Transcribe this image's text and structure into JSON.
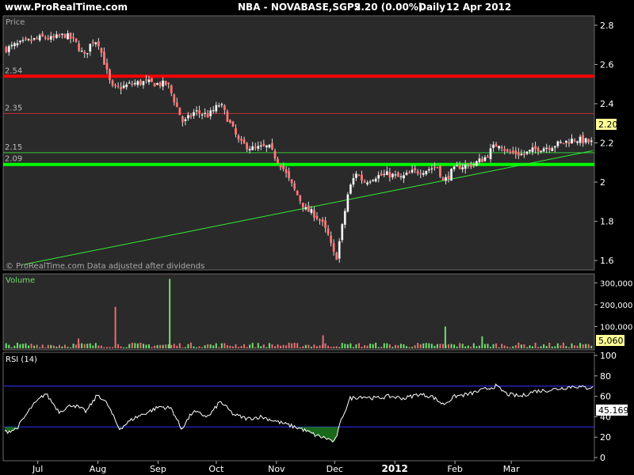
{
  "header": {
    "site": "www.ProRealTime.com",
    "instrument": "NBA - NOVABASE,SGPS",
    "price_change": "2.20 (0.00%)",
    "period": "Daily",
    "date": "12 Apr 2012"
  },
  "price_panel": {
    "label": "Price",
    "watermark": "© ProRealTime.com  Data adjusted after dividends",
    "axis_ticks": [
      "2.8",
      "2.6",
      "2.4",
      "2.2",
      "2",
      "1.8",
      "1.6"
    ],
    "last_price": "2.20"
  },
  "volume_panel": {
    "label": "Volume",
    "axis_ticks": [
      "300,000",
      "200,000",
      "100,000"
    ],
    "last_value": "5,060"
  },
  "rsi_panel": {
    "label": "RSI (14)",
    "axis_ticks": [
      "100",
      "80",
      "60",
      "40",
      "20",
      "0"
    ],
    "last_value": "45.169"
  },
  "x_axis": {
    "labels": [
      "Jul",
      "Aug",
      "Sep",
      "Oct",
      "Nov",
      "Dec",
      "2012",
      "Feb",
      "Mar"
    ]
  },
  "colors": {
    "up": "#ffffff",
    "down": "#ff7f7f",
    "vol_up": "#6fdd6f",
    "vol_down": "#e07070",
    "red_line": "#ff0000",
    "green_line": "#00ff00",
    "thin_red": "#c03030",
    "thin_green": "#33cc33",
    "trend": "#33ee33",
    "rsi_band": "#3333ff"
  },
  "chart_data": [
    {
      "type": "candlestick",
      "title": "",
      "ylabel": "Price",
      "ylim": [
        1.56,
        2.84
      ],
      "x_range": [
        "2011-06-14",
        "2012-04-12"
      ],
      "horizontal_lines": [
        {
          "value": 2.54,
          "label": "2.54",
          "color": "red",
          "style": "thick"
        },
        {
          "value": 2.35,
          "label": "2.35",
          "color": "red",
          "style": "thin"
        },
        {
          "value": 2.15,
          "label": "2.15",
          "color": "green",
          "style": "thin"
        },
        {
          "value": 2.09,
          "label": "2.09",
          "color": "green",
          "style": "thick"
        }
      ],
      "trendline": {
        "from": [
          "2011-06-24",
          1.58
        ],
        "to": [
          "2012-04-12",
          2.16
        ]
      },
      "close_path": [
        [
          "2011-06-15",
          2.68
        ],
        [
          "2011-06-20",
          2.7
        ],
        [
          "2011-06-27",
          2.72
        ],
        [
          "2011-07-04",
          2.74
        ],
        [
          "2011-07-08",
          2.73
        ],
        [
          "2011-07-15",
          2.75
        ],
        [
          "2011-07-20",
          2.72
        ],
        [
          "2011-07-25",
          2.64
        ],
        [
          "2011-07-29",
          2.72
        ],
        [
          "2011-08-01",
          2.72
        ],
        [
          "2011-08-04",
          2.62
        ],
        [
          "2011-08-08",
          2.48
        ],
        [
          "2011-08-12",
          2.48
        ],
        [
          "2011-08-18",
          2.5
        ],
        [
          "2011-08-25",
          2.51
        ],
        [
          "2011-09-01",
          2.5
        ],
        [
          "2011-09-06",
          2.5
        ],
        [
          "2011-09-10",
          2.4
        ],
        [
          "2011-09-14",
          2.3
        ],
        [
          "2011-09-20",
          2.36
        ],
        [
          "2011-09-27",
          2.34
        ],
        [
          "2011-10-03",
          2.4
        ],
        [
          "2011-10-08",
          2.3
        ],
        [
          "2011-10-13",
          2.2
        ],
        [
          "2011-10-20",
          2.17
        ],
        [
          "2011-10-28",
          2.18
        ],
        [
          "2011-11-01",
          2.12
        ],
        [
          "2011-11-04",
          2.08
        ],
        [
          "2011-11-08",
          2.0
        ],
        [
          "2011-11-12",
          1.93
        ],
        [
          "2011-11-16",
          1.86
        ],
        [
          "2011-11-20",
          1.84
        ],
        [
          "2011-11-24",
          1.8
        ],
        [
          "2011-11-28",
          1.72
        ],
        [
          "2011-11-30",
          1.64
        ],
        [
          "2011-12-02",
          1.62
        ],
        [
          "2011-12-05",
          1.78
        ],
        [
          "2011-12-08",
          1.95
        ],
        [
          "2011-12-12",
          2.05
        ],
        [
          "2011-12-16",
          2.0
        ],
        [
          "2011-12-22",
          2.03
        ],
        [
          "2011-12-29",
          2.04
        ],
        [
          "2012-01-04",
          2.02
        ],
        [
          "2012-01-10",
          2.05
        ],
        [
          "2012-01-16",
          2.06
        ],
        [
          "2012-01-23",
          2.08
        ],
        [
          "2012-01-26",
          2.0
        ],
        [
          "2012-01-30",
          2.05
        ],
        [
          "2012-02-03",
          2.08
        ],
        [
          "2012-02-10",
          2.09
        ],
        [
          "2012-02-16",
          2.12
        ],
        [
          "2012-02-21",
          2.18
        ],
        [
          "2012-02-24",
          2.2
        ],
        [
          "2012-02-28",
          2.15
        ],
        [
          "2012-03-02",
          2.15
        ],
        [
          "2012-03-07",
          2.14
        ],
        [
          "2012-03-14",
          2.17
        ],
        [
          "2012-03-20",
          2.18
        ],
        [
          "2012-03-27",
          2.2
        ],
        [
          "2012-04-03",
          2.22
        ],
        [
          "2012-04-12",
          2.2
        ]
      ]
    },
    {
      "type": "bar",
      "title": "",
      "ylabel": "Volume",
      "ylim": [
        0,
        330000
      ],
      "typical_volume": 14000,
      "peaks": [
        {
          "date": "2011-08-10",
          "value": 190000,
          "direction": "down"
        },
        {
          "date": "2011-09-07",
          "value": 318000,
          "direction": "up"
        },
        {
          "date": "2012-01-27",
          "value": 100000,
          "direction": "up"
        },
        {
          "date": "2012-02-15",
          "value": 55000,
          "direction": "up"
        },
        {
          "date": "2011-11-25",
          "value": 60000,
          "direction": "down"
        },
        {
          "date": "2011-07-22",
          "value": 45000,
          "direction": "down"
        }
      ],
      "last_value": 5060
    },
    {
      "type": "line",
      "title": "",
      "ylabel": "RSI (14)",
      "ylim": [
        0,
        100
      ],
      "bands": [
        70,
        30
      ],
      "series": [
        {
          "points": [
            [
              "2011-06-14",
              25
            ],
            [
              "2011-06-20",
              28
            ],
            [
              "2011-06-28",
              50
            ],
            [
              "2011-07-05",
              63
            ],
            [
              "2011-07-12",
              45
            ],
            [
              "2011-07-19",
              52
            ],
            [
              "2011-07-26",
              45
            ],
            [
              "2011-08-01",
              62
            ],
            [
              "2011-08-06",
              52
            ],
            [
              "2011-08-12",
              28
            ],
            [
              "2011-08-19",
              38
            ],
            [
              "2011-08-26",
              44
            ],
            [
              "2011-09-02",
              50
            ],
            [
              "2011-09-08",
              48
            ],
            [
              "2011-09-13",
              28
            ],
            [
              "2011-09-19",
              45
            ],
            [
              "2011-09-27",
              40
            ],
            [
              "2011-10-03",
              55
            ],
            [
              "2011-10-10",
              42
            ],
            [
              "2011-10-17",
              38
            ],
            [
              "2011-10-24",
              40
            ],
            [
              "2011-10-31",
              36
            ],
            [
              "2011-11-07",
              32
            ],
            [
              "2011-11-14",
              28
            ],
            [
              "2011-11-21",
              22
            ],
            [
              "2011-11-28",
              18
            ],
            [
              "2011-12-01",
              15
            ],
            [
              "2011-12-05",
              40
            ],
            [
              "2011-12-09",
              58
            ],
            [
              "2011-12-15",
              60
            ],
            [
              "2011-12-22",
              58
            ],
            [
              "2011-12-29",
              60
            ],
            [
              "2012-01-06",
              58
            ],
            [
              "2012-01-13",
              62
            ],
            [
              "2012-01-20",
              60
            ],
            [
              "2012-01-26",
              52
            ],
            [
              "2012-02-01",
              60
            ],
            [
              "2012-02-08",
              62
            ],
            [
              "2012-02-15",
              66
            ],
            [
              "2012-02-22",
              70
            ],
            [
              "2012-02-28",
              62
            ],
            [
              "2012-03-06",
              60
            ],
            [
              "2012-03-13",
              65
            ],
            [
              "2012-03-20",
              66
            ],
            [
              "2012-03-27",
              68
            ],
            [
              "2012-04-03",
              70
            ],
            [
              "2012-04-09",
              68
            ],
            [
              "2012-04-12",
              70
            ]
          ]
        }
      ]
    }
  ]
}
